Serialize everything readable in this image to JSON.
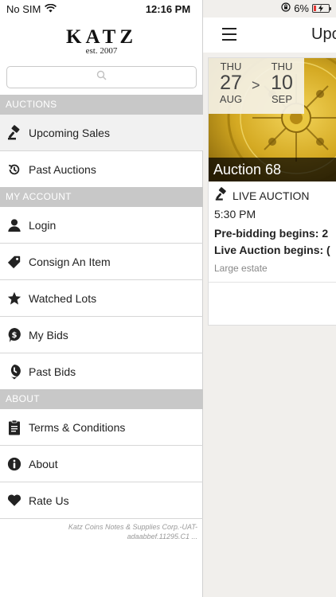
{
  "status_bar": {
    "carrier": "No SIM",
    "time": "12:16 PM",
    "battery": "6%"
  },
  "sidebar": {
    "logo": "KATZ",
    "logo_sub": "est. 2007",
    "search_placeholder": "",
    "sections": [
      {
        "title": "AUCTIONS",
        "items": [
          {
            "label": "Upcoming Sales",
            "icon": "gavel-icon",
            "active": true
          },
          {
            "label": "Past Auctions",
            "icon": "history-icon"
          }
        ]
      },
      {
        "title": "MY ACCOUNT",
        "items": [
          {
            "label": "Login",
            "icon": "person-icon"
          },
          {
            "label": "Consign An Item",
            "icon": "tag-icon"
          },
          {
            "label": "Watched Lots",
            "icon": "star-icon"
          },
          {
            "label": "My Bids",
            "icon": "dollar-bubble-icon"
          },
          {
            "label": "Past Bids",
            "icon": "clock-pin-icon"
          }
        ]
      },
      {
        "title": "ABOUT",
        "items": [
          {
            "label": "Terms & Conditions",
            "icon": "clipboard-icon"
          },
          {
            "label": "About",
            "icon": "info-icon"
          },
          {
            "label": "Rate Us",
            "icon": "heart-icon"
          }
        ]
      }
    ],
    "version_line1": "Katz Coins Notes & Supplies Corp.-UAT-",
    "version_line2": "adaabbef.11295.C1 ..."
  },
  "main": {
    "title": "Upc",
    "card": {
      "start_dow": "THU",
      "start_day": "27",
      "start_month": "AUG",
      "arrow": ">",
      "end_dow": "THU",
      "end_day": "10",
      "end_month": "SEP",
      "auction_name": "Auction 68",
      "type": "LIVE AUCTION",
      "time": "5:30 PM",
      "prebid": "Pre-bidding begins: 2",
      "live_begins": "Live Auction begins: (",
      "description": "Large estate"
    }
  },
  "colors": {
    "section_header_bg": "#c8c8c8",
    "active_item_bg": "#f1f1f1",
    "main_bg": "#f1efec",
    "coin_gold": "#c59b1a"
  }
}
